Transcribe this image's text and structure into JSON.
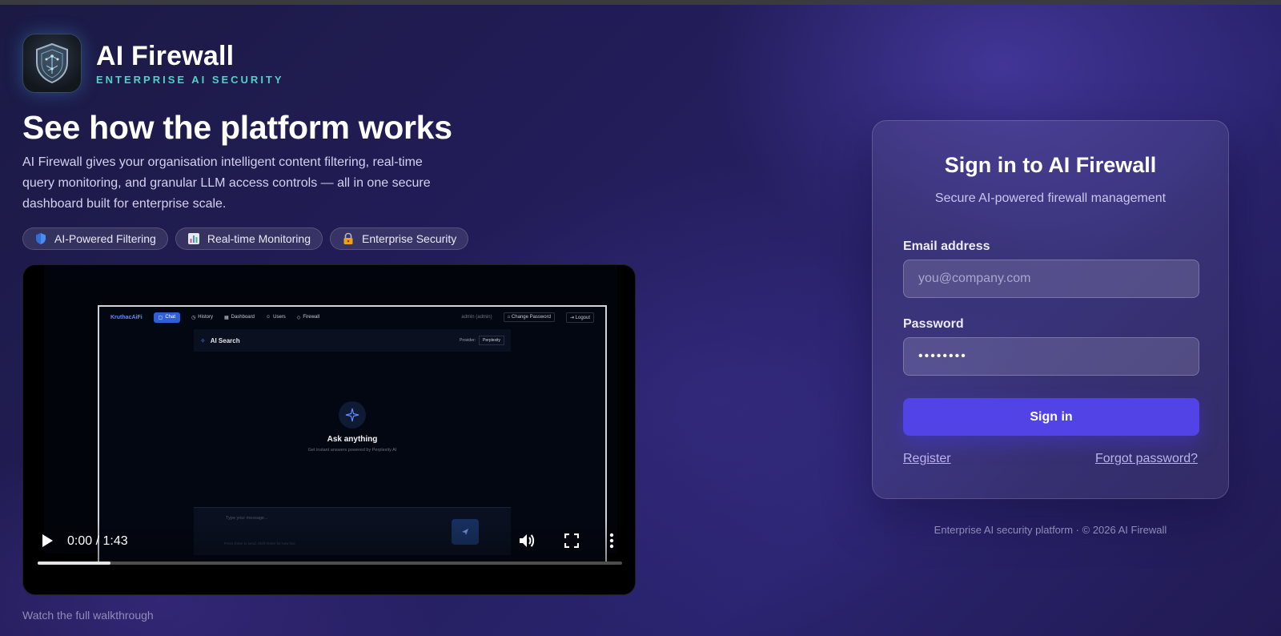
{
  "brand": {
    "title": "AI Firewall",
    "subtitle": "ENTERPRISE AI SECURITY",
    "logo_icon": "shield-circuit-icon"
  },
  "hero": {
    "headline": "See how the platform works",
    "description": "AI Firewall gives your organisation intelligent content filtering, real-time query monitoring, and granular LLM access controls — all in one secure dashboard built for enterprise scale."
  },
  "pills": [
    {
      "label": "AI-Powered Filtering",
      "icon": "shield-icon"
    },
    {
      "label": "Real-time Monitoring",
      "icon": "bar-chart-icon"
    },
    {
      "label": "Enterprise Security",
      "icon": "lock-icon"
    }
  ],
  "video": {
    "time": "0:00 / 1:43",
    "progress": 0.124,
    "caption": "Watch the full walkthrough",
    "screen": {
      "brand": "KruthacAiFi",
      "tabs": [
        "Chat",
        "History",
        "Dashboard",
        "Users",
        "Firewall"
      ],
      "user": "admin (admin)",
      "change_password": "Change Password",
      "logout": "Logout",
      "panel_title": "AI Search",
      "provider_label": "Provider:",
      "provider_value": "Perplexity",
      "ask_title": "Ask anything",
      "ask_desc": "Get instant answers powered by Perplexity AI",
      "input_placeholder": "Type your message...",
      "input_hint": "Press Enter to send, Shift+Enter for new line"
    }
  },
  "signin": {
    "title": "Sign in to AI Firewall",
    "subtitle": "Secure AI-powered firewall management",
    "email_label": "Email address",
    "email_placeholder": "you@company.com",
    "password_label": "Password",
    "password_value": "••••••••",
    "button": "Sign in",
    "register": "Register",
    "forgot": "Forgot password?"
  },
  "footer": "Enterprise AI security platform · © 2026 AI Firewall",
  "colors": {
    "accent": "#5143e6",
    "brand_sub": "#4fd1c5"
  }
}
